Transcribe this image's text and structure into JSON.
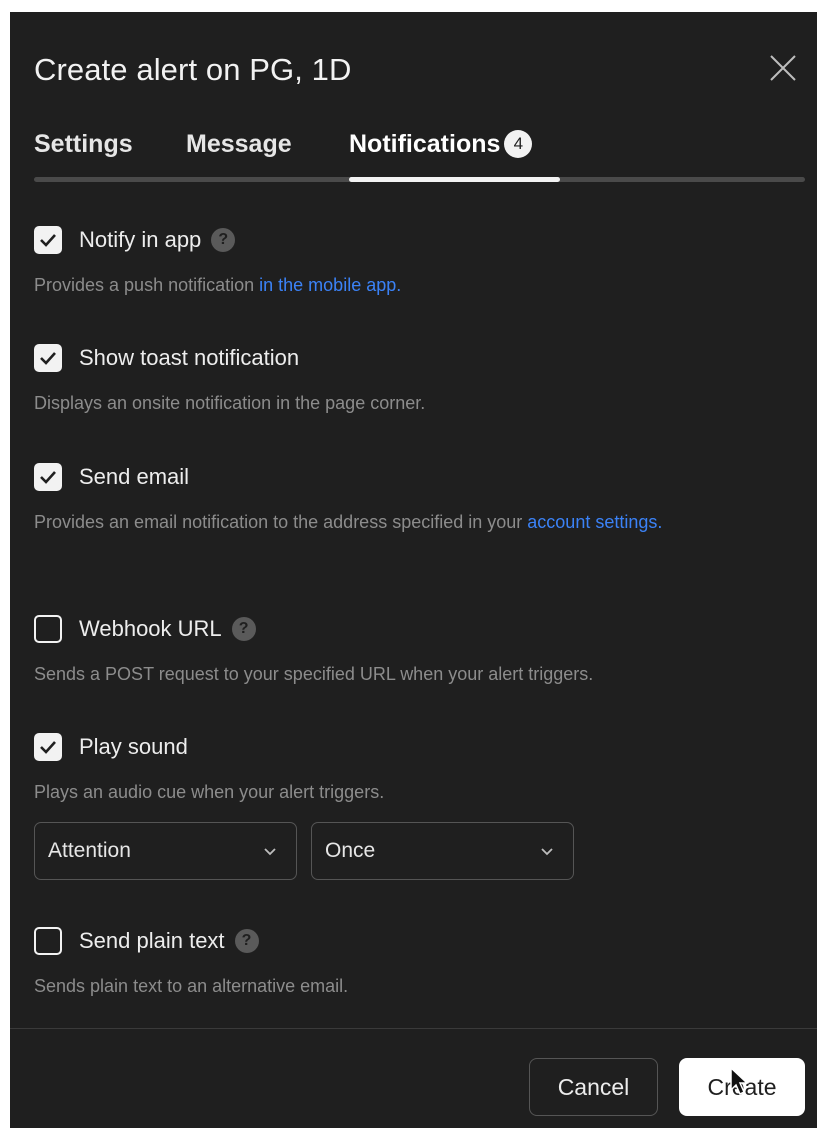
{
  "dialog": {
    "title": "Create alert on PG, 1D",
    "tabs": [
      {
        "label": "Settings"
      },
      {
        "label": "Message"
      },
      {
        "label": "Notifications",
        "badge": "4"
      }
    ],
    "options": {
      "notify_app": {
        "label": "Notify in app",
        "checked": true,
        "desc_prefix": "Provides a push notification ",
        "desc_link": "in the mobile app."
      },
      "toast": {
        "label": "Show toast notification",
        "checked": true,
        "desc": "Displays an onsite notification in the page corner."
      },
      "email": {
        "label": "Send email",
        "checked": true,
        "desc_prefix": "Provides an email notification to the address specified in your ",
        "desc_link": "account settings."
      },
      "webhook": {
        "label": "Webhook URL",
        "checked": false,
        "desc": "Sends a POST request to your specified URL when your alert triggers."
      },
      "sound": {
        "label": "Play sound",
        "checked": true,
        "desc": "Plays an audio cue when your alert triggers.",
        "sound_value": "Attention",
        "repeat_value": "Once"
      },
      "plain_text": {
        "label": "Send plain text",
        "checked": false,
        "desc": "Sends plain text to an alternative email."
      }
    },
    "buttons": {
      "cancel": "Cancel",
      "create": "Create"
    }
  },
  "icons": {
    "close": "close-icon",
    "check": "check-icon",
    "help": "question-icon",
    "chevron": "chevron-down-icon",
    "cursor": "mouse-pointer-icon"
  },
  "colors": {
    "background": "#1f1f1f",
    "link": "#3b82f6",
    "muted_text": "#8c8c8c"
  }
}
